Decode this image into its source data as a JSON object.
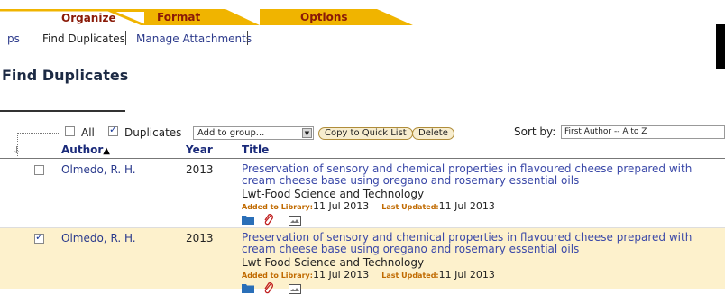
{
  "tabs": {
    "organize": "Organize",
    "format": "Format",
    "options": "Options"
  },
  "subnav": {
    "items": [
      "ps",
      "Find Duplicates",
      "Manage Attachments"
    ]
  },
  "page_title": "Find Duplicates",
  "toolbar": {
    "all_label": "All",
    "duplicates_label": "Duplicates",
    "add_to_group_value": "Add to group...",
    "copy_button": "Copy to Quick List",
    "delete_button": "Delete",
    "sort_by_label": "Sort by:",
    "sort_value": "First Author -- A to Z"
  },
  "columns": {
    "author": "Author",
    "year": "Year",
    "title": "Title"
  },
  "rows": [
    {
      "checked": false,
      "author": "Olmedo, R. H.",
      "year": "2013",
      "title": "Preservation of sensory and chemical properties in flavoured cheese prepared with cream cheese base using oregano and rosemary essential oils",
      "journal": "Lwt-Food Science and Technology",
      "added_label": "Added to Library:",
      "added_date": "11 Jul 2013",
      "updated_label": "Last Updated:",
      "updated_date": "11 Jul 2013"
    },
    {
      "checked": true,
      "author": "Olmedo, R. H.",
      "year": "2013",
      "title": "Preservation of sensory and chemical properties in flavoured cheese prepared with cream cheese base using oregano and rosemary essential oils",
      "journal": "Lwt-Food Science and Technology",
      "added_label": "Added to Library:",
      "added_date": "11 Jul 2013",
      "updated_label": "Last Updated:",
      "updated_date": "11 Jul 2013"
    }
  ],
  "colors": {
    "tab_gold": "#f0b400",
    "row_highlight": "#fdf1cc",
    "link_blue": "#3a48a8"
  },
  "icons": [
    "folder-icon",
    "paperclip-icon",
    "image-icon",
    "sort-ascending-icon"
  ]
}
